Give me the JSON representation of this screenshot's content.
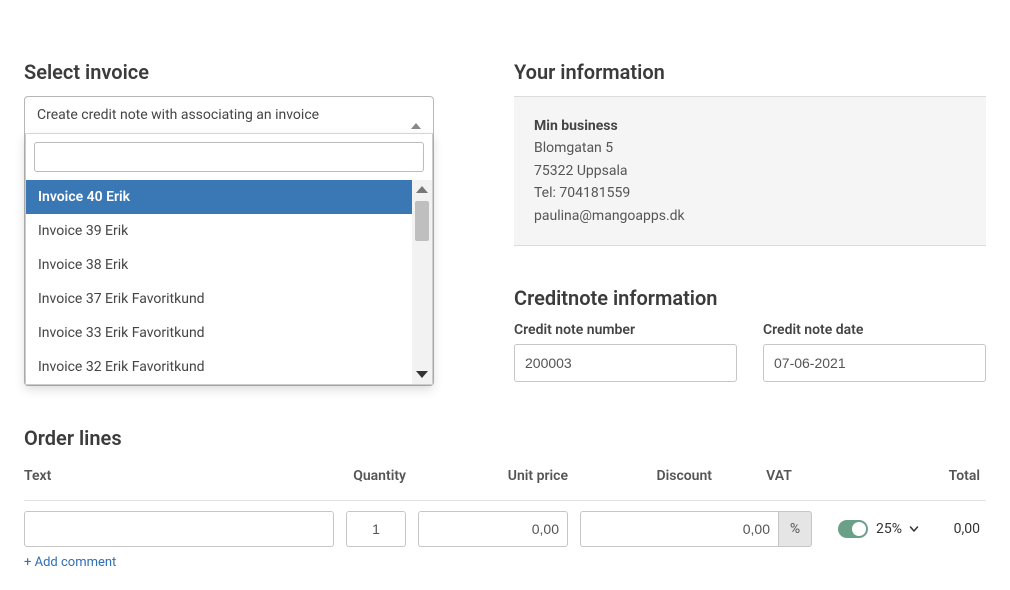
{
  "left": {
    "select_invoice_title": "Select invoice",
    "selected_label": "Create credit note with associating an invoice",
    "search_value": "",
    "options": [
      "Invoice 40 Erik",
      "Invoice 39 Erik",
      "Invoice 38 Erik",
      "Invoice 37 Erik Favoritkund",
      "Invoice 33 Erik Favoritkund",
      "Invoice 32 Erik Favoritkund"
    ]
  },
  "right": {
    "your_info_title": "Your information",
    "business": {
      "name": "Min business",
      "address1": "Blomgatan 5",
      "address2": "75322 Uppsala",
      "phone": "Tel: 704181559",
      "email": "paulina@mangoapps.dk"
    },
    "credit_title": "Creditnote information",
    "number_label": "Credit note number",
    "date_label": "Credit note date",
    "number_value": "200003",
    "date_value": "07-06-2021"
  },
  "order": {
    "title": "Order lines",
    "headers": {
      "text": "Text",
      "qty": "Quantity",
      "price": "Unit price",
      "disc": "Discount",
      "vat": "VAT",
      "total": "Total"
    },
    "row": {
      "text": "",
      "qty": "1",
      "price": "0,00",
      "disc": "0,00",
      "pct_symbol": "%",
      "vat_rate": "25%",
      "total": "0,00"
    },
    "add_comment": "+ Add comment"
  }
}
